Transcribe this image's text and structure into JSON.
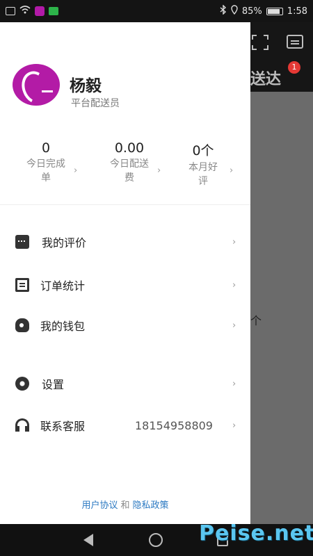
{
  "status_bar": {
    "battery": "85%",
    "time": "1:58"
  },
  "background": {
    "tab_label": "送达",
    "badge": "1",
    "count_suffix": "个"
  },
  "profile": {
    "name": "杨毅",
    "role": "平台配送员"
  },
  "stats": [
    {
      "value": "0",
      "label_line1": "今日完成",
      "label_line2": "单"
    },
    {
      "value": "0.00",
      "label_line1": "今日配送",
      "label_line2": "费"
    },
    {
      "value": "0个",
      "label_line1": "本月好",
      "label_line2": "评"
    }
  ],
  "menu": {
    "reviews": "我的评价",
    "order_stats": "订单统计",
    "wallet": "我的钱包",
    "settings": "设置",
    "support": "联系客服",
    "support_phone": "18154958809"
  },
  "footer": {
    "user_agreement": "用户协议",
    "and": "和",
    "privacy_policy": "隐私政策"
  },
  "watermark": "Peise.net"
}
